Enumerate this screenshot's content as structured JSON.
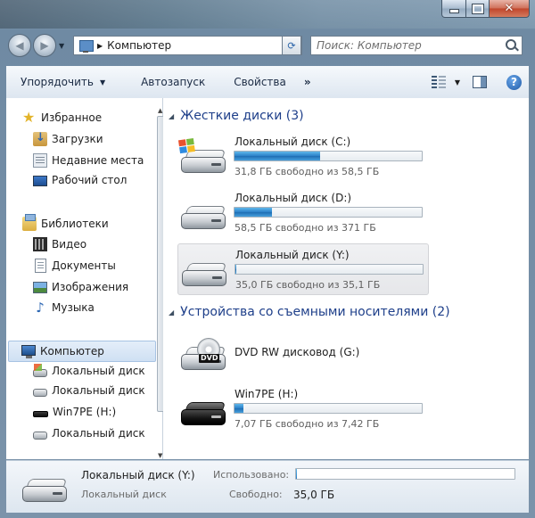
{
  "window": {
    "caption_buttons": {
      "minimize": "–",
      "maximize": "□",
      "close": "✕"
    }
  },
  "nav": {
    "back_icon": "back-arrow-icon",
    "forward_icon": "forward-arrow-icon",
    "address": {
      "separator": "▶",
      "location": "Компьютер"
    },
    "refresh_icon": "refresh-icon",
    "search_placeholder": "Поиск: Компьютер"
  },
  "toolbar": {
    "organize_label": "Упорядочить",
    "autoplay_label": "Автозапуск",
    "properties_label": "Свойства",
    "more_label": "»",
    "help_label": "?"
  },
  "sidebar": {
    "favorites": {
      "label": "Избранное",
      "items": [
        {
          "label": "Загрузки",
          "icon": "downloads-icon"
        },
        {
          "label": "Недавние места",
          "icon": "recent-places-icon"
        },
        {
          "label": "Рабочий стол",
          "icon": "desktop-icon"
        }
      ]
    },
    "libraries": {
      "label": "Библиотеки",
      "items": [
        {
          "label": "Видео",
          "icon": "video-icon"
        },
        {
          "label": "Документы",
          "icon": "documents-icon"
        },
        {
          "label": "Изображения",
          "icon": "images-icon"
        },
        {
          "label": "Музыка",
          "icon": "music-icon"
        }
      ]
    },
    "computer": {
      "label": "Компьютер",
      "items": [
        {
          "label": "Локальный диск",
          "icon": "system-disk-icon"
        },
        {
          "label": "Локальный диск",
          "icon": "disk-icon"
        },
        {
          "label": "Win7PE (H:)",
          "icon": "usb-drive-icon"
        },
        {
          "label": "Локальный диск",
          "icon": "disk-icon"
        }
      ]
    }
  },
  "main": {
    "hard_disks_header": "Жесткие диски (3)",
    "removable_header": "Устройства со съемными носителями (2)",
    "hard_disks": [
      {
        "name": "Локальный диск (C:)",
        "free_text": "31,8 ГБ свободно из 58,5 ГБ",
        "used_fraction": 0.456
      },
      {
        "name": "Локальный диск (D:)",
        "free_text": "58,5 ГБ свободно из 371 ГБ",
        "used_fraction": 0.2
      },
      {
        "name": "Локальный диск (Y:)",
        "free_text": "35,0 ГБ свободно из 35,1 ГБ",
        "used_fraction": 0.003
      }
    ],
    "removable": [
      {
        "name": "DVD RW дисковод (G:)",
        "badge": "DVD"
      },
      {
        "name": "Win7PE (H:)",
        "free_text": "7,07 ГБ свободно из 7,42 ГБ",
        "used_fraction": 0.047
      }
    ]
  },
  "details": {
    "name": "Локальный диск (Y:)",
    "type": "Локальный диск",
    "used_label": "Использовано:",
    "free_label": "Свободно:",
    "free_value": "35,0 ГБ",
    "used_fraction": 0.003
  },
  "colors": {
    "group_header": "#1e3f8a",
    "usage_bar": "#2a7fc7",
    "selection": "#cfe0f3"
  }
}
